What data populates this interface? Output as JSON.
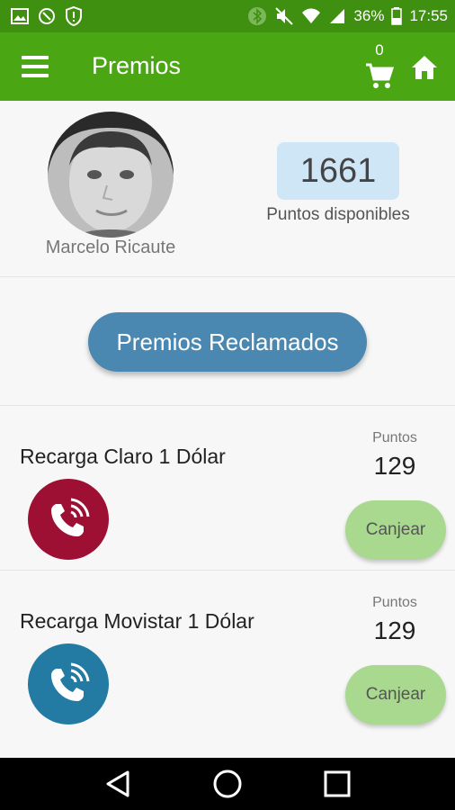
{
  "status_bar": {
    "battery": "36%",
    "time": "17:55"
  },
  "app_bar": {
    "title": "Premios",
    "cart_count": "0"
  },
  "profile": {
    "name": "Marcelo Ricaute",
    "points": "1661",
    "points_label": "Puntos disponibles"
  },
  "claimed_button": "Premios Reclamados",
  "rewards": [
    {
      "title": "Recarga Claro 1 Dólar",
      "points_label": "Puntos",
      "points": "129",
      "button": "Canjear",
      "icon_color": "#9e1033"
    },
    {
      "title": "Recarga Movistar 1 Dólar",
      "points_label": "Puntos",
      "points": "129",
      "button": "Canjear",
      "icon_color": "#237ba4"
    }
  ],
  "colors": {
    "status_bar": "#3f8f10",
    "app_bar": "#4aa613",
    "claimed_button": "#4a88b2",
    "canjear_button": "#a8d98f",
    "points_box": "#cfe6f7"
  },
  "icons": [
    "image-icon",
    "shield-icon",
    "alert-icon",
    "bluetooth-icon",
    "mute-icon",
    "wifi-icon",
    "signal-icon",
    "battery-icon",
    "menu-icon",
    "cart-icon",
    "home-icon",
    "phone-call-icon",
    "back-icon",
    "home-circle-icon",
    "recents-icon"
  ]
}
